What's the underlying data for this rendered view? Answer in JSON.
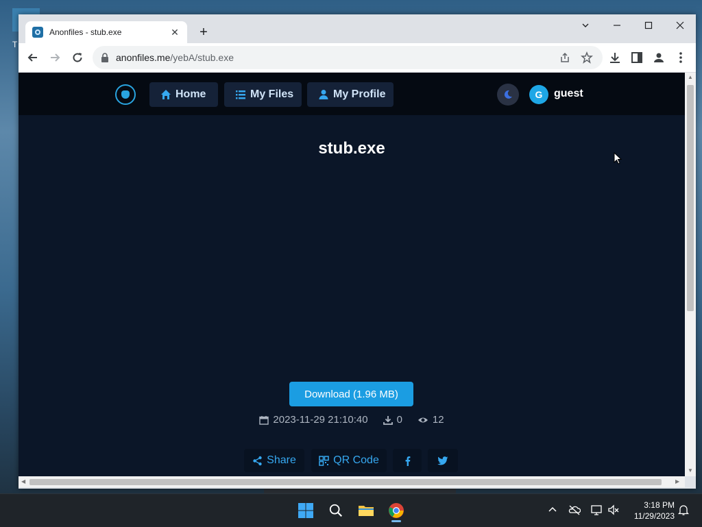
{
  "browser": {
    "tab_title": "Anonfiles - stub.exe",
    "url_host": "anonfiles.me",
    "url_path": "/yebA/stub.exe"
  },
  "site": {
    "nav": {
      "home": "Home",
      "my_files": "My Files",
      "my_profile": "My Profile"
    },
    "avatar_letter": "G",
    "username": "guest"
  },
  "file": {
    "name": "stub.exe",
    "download_label": "Download (1.96 MB)",
    "uploaded": "2023-11-29 21:10:40",
    "downloads": "0",
    "views": "12"
  },
  "share": {
    "share_label": "Share",
    "qr_label": "QR Code"
  },
  "taskbar": {
    "time": "3:18 PM",
    "date": "11/29/2023"
  },
  "colors": {
    "page_bg": "#0b1628",
    "nav_bg": "#050a12",
    "accent": "#1b9de2",
    "link": "#36a8f0"
  }
}
